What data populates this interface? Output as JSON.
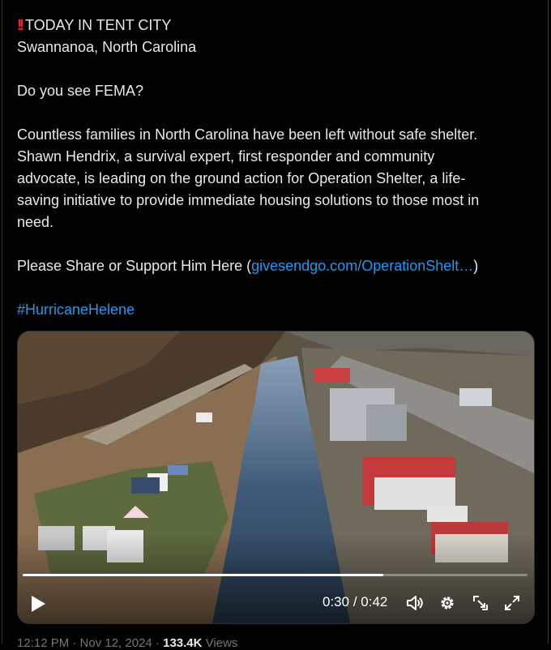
{
  "tweet": {
    "title": "TODAY IN TENT CITY",
    "location": "Swannanoa, North Carolina",
    "question": "Do you see FEMA?",
    "body_lines": [
      "Countless families in North Carolina have been left without safe shelter.",
      "Shawn Hendrix, a survival expert, first responder and community",
      "advocate, is leading on the ground action for Operation Shelter, a life-",
      "saving initiative to provide immediate housing solutions to those most in",
      "need."
    ],
    "cta_prefix": "Please Share or Support Him Here (",
    "cta_link": "givesendgo.com/OperationShelt…",
    "cta_suffix": ")",
    "hashtag": "#HurricaneHelene"
  },
  "video": {
    "current_time": "0:30",
    "separator": " / ",
    "duration": "0:42",
    "progress_fraction": 0.715
  },
  "footer": {
    "timestamp": "12:12 PM · Nov 12, 2024",
    "separator": " · ",
    "views_count": "133.4K",
    "views_label": "Views"
  },
  "colors": {
    "background": "#000000",
    "text": "#e7e9ea",
    "link": "#1d9bf0",
    "alert": "#f4212e"
  },
  "icons": [
    "double-exclamation-icon",
    "play-icon",
    "volume-icon",
    "settings-gear-icon",
    "exit-picture-icon",
    "fullscreen-icon"
  ]
}
